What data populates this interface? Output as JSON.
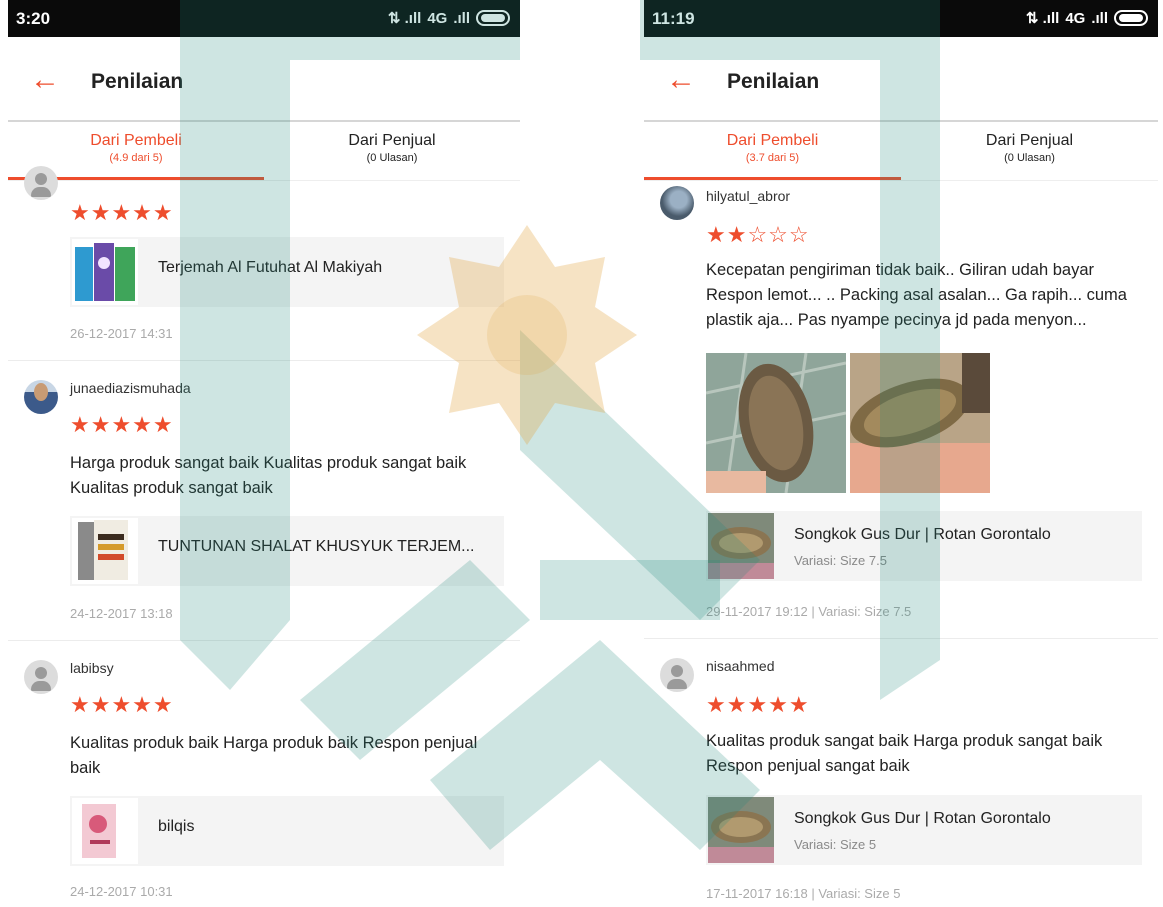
{
  "left": {
    "status": {
      "time": "3:20",
      "network": "4G",
      "signal_glyph": "⇅ .ıll",
      "signal2_glyph": ".ıll"
    },
    "appbar": {
      "title": "Penilaian"
    },
    "tabs": [
      {
        "label": "Dari Pembeli",
        "sub": "(4.9 dari 5)"
      },
      {
        "label": "Dari Penjual",
        "sub": "(0 Ulasan)"
      }
    ],
    "reviews": [
      {
        "stars": "★★★★★",
        "product": "Terjemah Al Futuhat Al Makiyah",
        "date": "26-12-2017 14:31"
      },
      {
        "username": "junaediazismuhada",
        "stars": "★★★★★",
        "comment": "Harga produk sangat baik Kualitas produk sangat baik Kualitas produk sangat baik",
        "product": "TUNTUNAN SHALAT KHUSYUK TERJEM...",
        "date": "24-12-2017 13:18"
      },
      {
        "username": "labibsy",
        "stars": "★★★★★",
        "comment": "Kualitas produk baik Harga produk baik Respon penjual baik",
        "product": "bilqis",
        "date": "24-12-2017 10:31"
      }
    ]
  },
  "right": {
    "status": {
      "time": "11:19",
      "network": "4G",
      "signal_glyph": "⇅ .ıll",
      "signal2_glyph": ".ıll"
    },
    "appbar": {
      "title": "Penilaian"
    },
    "tabs": [
      {
        "label": "Dari Pembeli",
        "sub": "(3.7 dari 5)"
      },
      {
        "label": "Dari Penjual",
        "sub": "(0 Ulasan)"
      }
    ],
    "reviews": [
      {
        "username": "hilyatul_abror",
        "stars": "★★☆☆☆",
        "comment": "Kecepatan pengiriman tidak baik.. Giliran udah bayar Respon lemot... .. Packing asal asalan... Ga rapih... cuma plastik aja... Pas nyampe pecinya jd pada menyon...",
        "product": "Songkok Gus Dur | Rotan Gorontalo",
        "variant": "Variasi: Size 7.5",
        "date": "29-11-2017 19:12",
        "date_variant": "Variasi:  Size 7.5"
      },
      {
        "username": "nisaahmed",
        "stars": "★★★★★",
        "comment": "Kualitas produk sangat baik Harga produk sangat baik Respon penjual sangat baik",
        "product": "Songkok Gus Dur | Rotan Gorontalo",
        "variant": "Variasi: Size 5",
        "date": "17-11-2017 16:18",
        "date_variant": "Variasi:  Size 5"
      }
    ]
  },
  "colors": {
    "accent": "#ee4d2d",
    "watermark_green": "#1f8a7a",
    "watermark_gold": "#e0a23c"
  }
}
